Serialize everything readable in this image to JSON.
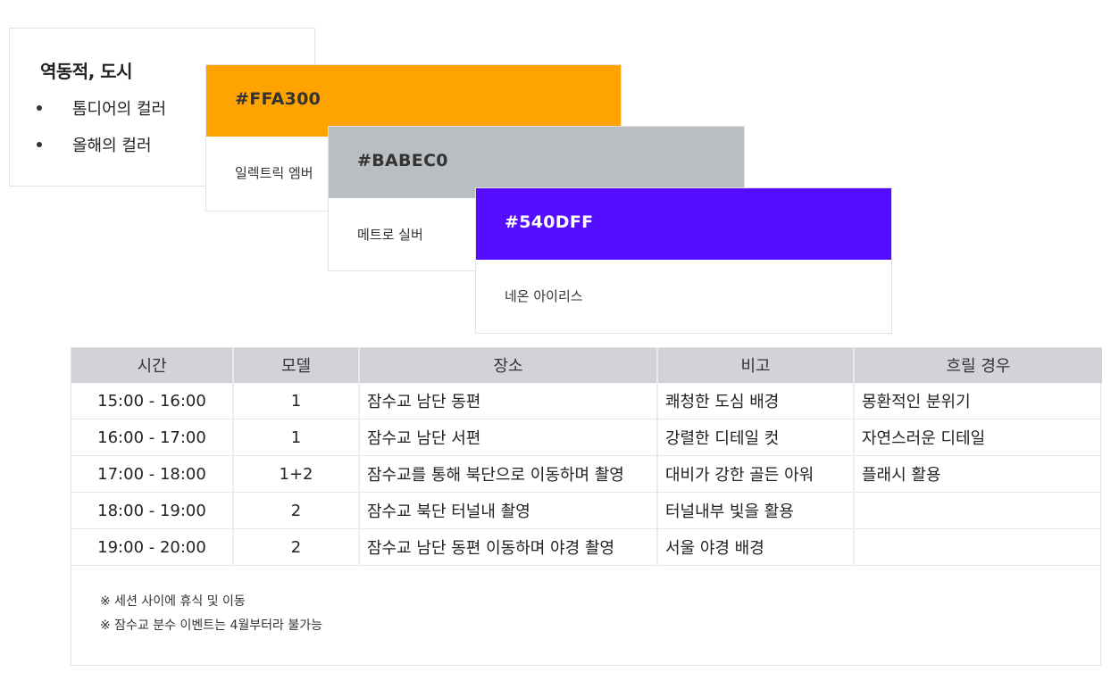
{
  "theme": {
    "title": "역동적, 도시",
    "items": [
      "톰디어의 컬러",
      "올해의 컬러"
    ]
  },
  "swatches": [
    {
      "hex": "#FFA300",
      "name": "일렉트릭 엠버",
      "color": "#FFA300",
      "text_color": "#333333"
    },
    {
      "hex": "#BABEC0",
      "name": "메트로 실버",
      "color": "#BABEC0",
      "text_color": "#333333"
    },
    {
      "hex": "#540DFF",
      "name": "네온 아이리스",
      "color": "#540DFF",
      "text_color": "#ffffff"
    }
  ],
  "schedule": {
    "headers": [
      "시간",
      "모델",
      "장소",
      "비고",
      "흐릴 경우"
    ],
    "rows": [
      [
        "15:00 - 16:00",
        "1",
        "잠수교 남단 동편",
        "쾌청한 도심 배경",
        "몽환적인 분위기"
      ],
      [
        "16:00 - 17:00",
        "1",
        "잠수교 남단 서편",
        "강렬한 디테일 컷",
        "자연스러운 디테일"
      ],
      [
        "17:00 - 18:00",
        "1+2",
        "잠수교를 통해 북단으로 이동하며 촬영",
        "대비가 강한 골든 아워",
        "플래시 활용"
      ],
      [
        "18:00 - 19:00",
        "2",
        "잠수교 북단 터널내 촬영",
        "터널내부 빛을 활용",
        ""
      ],
      [
        "19:00 - 20:00",
        "2",
        "잠수교 남단 동편 이동하며 야경 촬영",
        "서울 야경 배경",
        ""
      ]
    ],
    "notes": [
      "※ 세션 사이에 휴식 및 이동",
      "※ 잠수교 분수 이벤트는 4월부터라 불가능"
    ]
  }
}
